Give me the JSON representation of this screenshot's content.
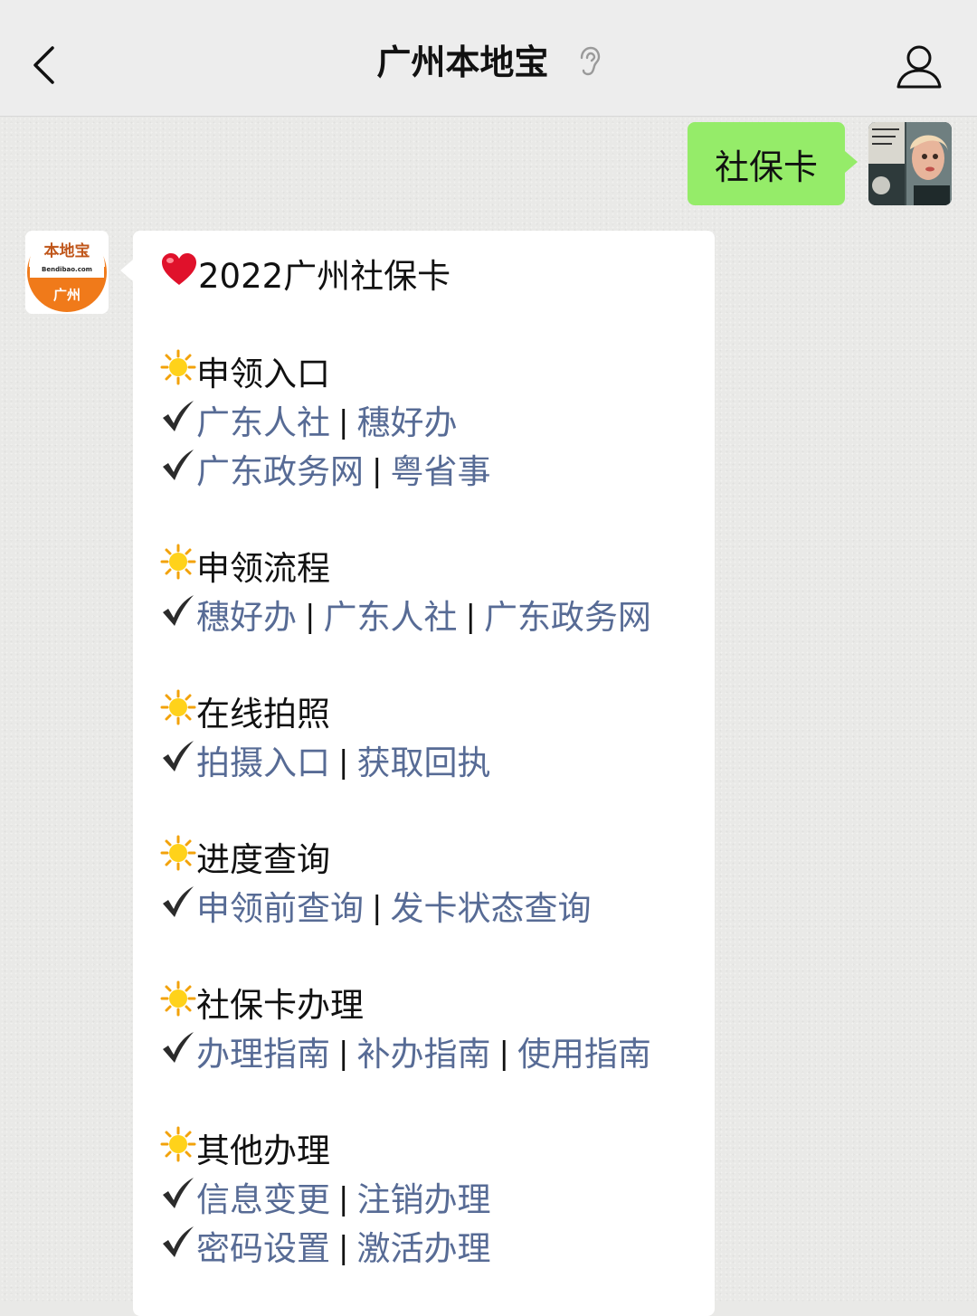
{
  "header": {
    "title": "广州本地宝"
  },
  "outgoing": {
    "text": "社保卡"
  },
  "bot_avatar": {
    "top_text": "本地宝",
    "site_text": "Bendibao.com",
    "city_text": "广州"
  },
  "message": {
    "title": "2022广州社保卡",
    "sections": [
      {
        "heading": "申领入口",
        "rows": [
          [
            "广东人社",
            "穗好办"
          ],
          [
            "广东政务网",
            "粤省事"
          ]
        ]
      },
      {
        "heading": "申领流程",
        "rows": [
          [
            "穗好办",
            "广东人社",
            "广东政务网"
          ]
        ]
      },
      {
        "heading": "在线拍照",
        "rows": [
          [
            "拍摄入口",
            "获取回执"
          ]
        ]
      },
      {
        "heading": "进度查询",
        "rows": [
          [
            "申领前查询",
            "发卡状态查询"
          ]
        ]
      },
      {
        "heading": "社保卡办理",
        "rows": [
          [
            "办理指南",
            "补办指南",
            "使用指南"
          ]
        ]
      },
      {
        "heading": "其他办理",
        "rows": [
          [
            "信息变更",
            "注销办理"
          ],
          [
            "密码设置",
            "激活办理"
          ]
        ]
      }
    ],
    "separator": "|"
  },
  "colors": {
    "link": "#576b95",
    "outgoing_bubble": "#95ec69",
    "brand_orange": "#f07a1a"
  },
  "icons": {
    "title": "heart-icon",
    "heading": "sun-icon",
    "row": "checkmark-icon"
  }
}
